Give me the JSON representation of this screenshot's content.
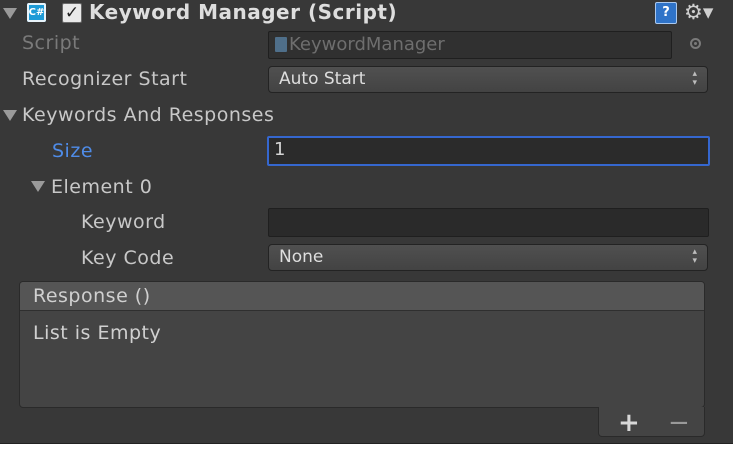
{
  "header": {
    "title": "Keyword Manager (Script)",
    "cs_icon_glyph": "C#",
    "checkbox_checked": true,
    "help_glyph": "?",
    "gear_glyph": "⚙▾"
  },
  "fields": {
    "script": {
      "label": "Script",
      "value": "KeywordManager"
    },
    "recognizer_start": {
      "label": "Recognizer Start",
      "value": "Auto Start"
    },
    "keywords_and_responses": {
      "label": "Keywords And Responses"
    },
    "size": {
      "label": "Size",
      "value": "1"
    },
    "element0": {
      "label": "Element 0"
    },
    "keyword": {
      "label": "Keyword",
      "value": ""
    },
    "key_code": {
      "label": "Key Code",
      "value": "None"
    }
  },
  "event": {
    "header": "Response ()",
    "empty_text": "List is Empty",
    "add_label": "+",
    "remove_label": "−"
  },
  "colors": {
    "background": "#383838",
    "size_label_blue": "#4f8ce8",
    "focus_border": "#3567cf"
  },
  "icons": {
    "foldout": "triangle-down-icon",
    "script_file": "script-file-icon",
    "object_picker": "target-icon",
    "popup_arrows": "updown-arrows-icon"
  }
}
